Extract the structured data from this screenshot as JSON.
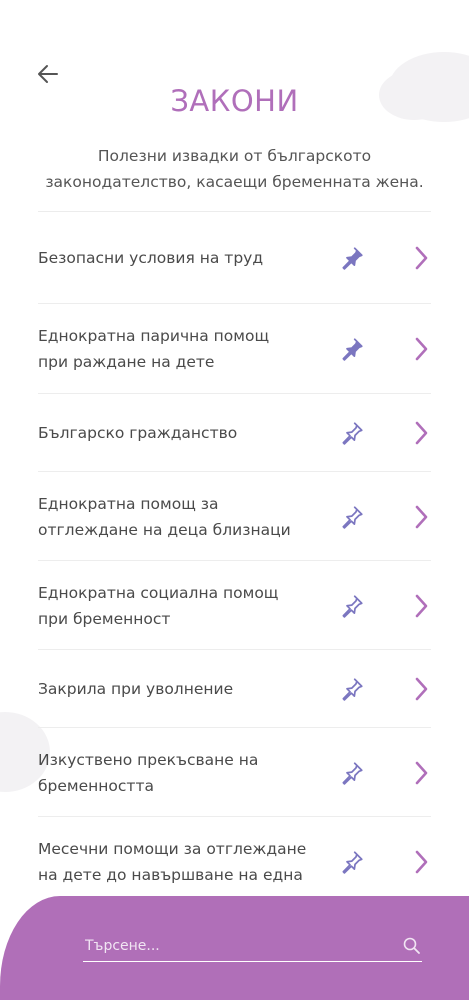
{
  "header": {
    "title": "ЗАКОНИ",
    "subtitle_line1": "Полезни извадки от българското",
    "subtitle_line2": "законодателство, касаещи бременната жена."
  },
  "items": [
    {
      "line1": "Безопасни условия на труд",
      "line2": "",
      "pinned": true
    },
    {
      "line1": "Еднократна парична помощ",
      "line2": "при раждане на дете",
      "pinned": true
    },
    {
      "line1": "Българско гражданство",
      "line2": "",
      "pinned": false
    },
    {
      "line1": "Еднократна помощ за",
      "line2": "отглеждане на деца близнаци",
      "pinned": false
    },
    {
      "line1": "Еднократна социална помощ",
      "line2": "при бременност",
      "pinned": false
    },
    {
      "line1": "Закрила при уволнение",
      "line2": "",
      "pinned": false
    },
    {
      "line1": "Изкуствено прекъсване на",
      "line2": "бременността",
      "pinned": false
    },
    {
      "line1": "Месечни помощи за отглеждане",
      "line2": "на дете до навършване на една",
      "pinned": false
    }
  ],
  "search": {
    "placeholder": "Търсене..."
  },
  "colors": {
    "accent": "#b06fba",
    "pin_filled": "#7b76c0",
    "pin_outline": "#7b76c0",
    "chevron": "#b06fba",
    "bottom_bar": "#b06fb8"
  }
}
